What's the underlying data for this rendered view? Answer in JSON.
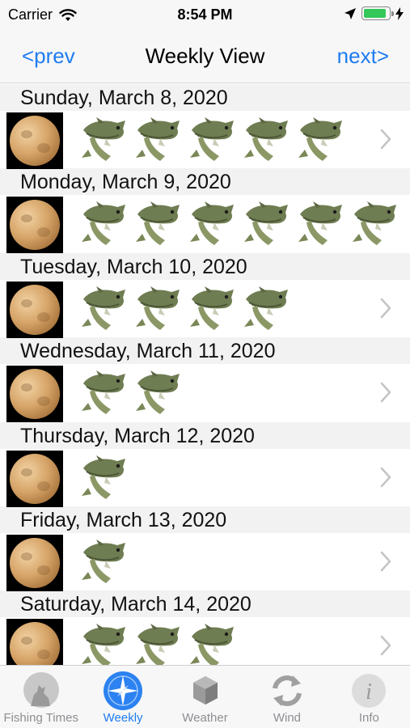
{
  "status_bar": {
    "carrier": "Carrier",
    "time": "8:54 PM",
    "battery_level": 0.9,
    "icons": [
      "wifi-icon",
      "location-arrow-icon",
      "battery-icon",
      "charging-bolt-icon"
    ]
  },
  "nav": {
    "prev_label": "<prev",
    "title": "Weekly View",
    "next_label": "next>"
  },
  "days": [
    {
      "date": "Sunday, March 8, 2020",
      "fish_count": 5
    },
    {
      "date": "Monday, March 9, 2020",
      "fish_count": 6
    },
    {
      "date": "Tuesday, March 10, 2020",
      "fish_count": 4
    },
    {
      "date": "Wednesday, March 11, 2020",
      "fish_count": 2
    },
    {
      "date": "Thursday, March 12, 2020",
      "fish_count": 1
    },
    {
      "date": "Friday, March 13, 2020",
      "fish_count": 1
    },
    {
      "date": "Saturday, March 14, 2020",
      "fish_count": 3
    }
  ],
  "tabs": [
    {
      "label": "Fishing Times",
      "icon": "moon-wolf-icon",
      "active": false
    },
    {
      "label": "Weekly",
      "icon": "compass-icon",
      "active": true
    },
    {
      "label": "Weather",
      "icon": "weather-icon",
      "active": false
    },
    {
      "label": "Wind",
      "icon": "wind-arrows-icon",
      "active": false
    },
    {
      "label": "Info",
      "icon": "info-icon",
      "active": false
    }
  ],
  "colors": {
    "accent": "#1e7cf2",
    "tab_inactive": "#8e8e93",
    "header_bg": "#f2f2f2",
    "battery": "#34c759"
  }
}
